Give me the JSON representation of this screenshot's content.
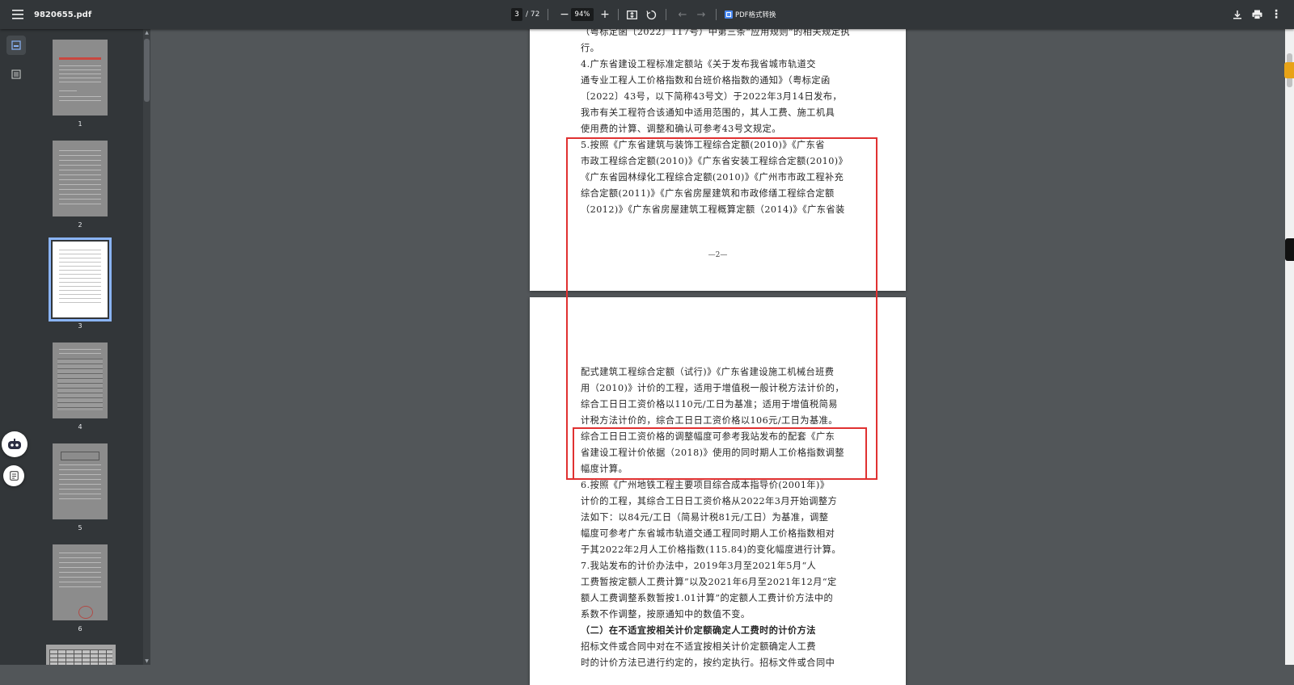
{
  "toolbar": {
    "file_name": "9820655.pdf",
    "current_page": "3",
    "page_total": "/ 72",
    "zoom": "94%",
    "zoom_out": "−",
    "zoom_in": "+",
    "back": "←",
    "forward": "→",
    "convert_label": "PDF格式转换",
    "more": "⋮"
  },
  "thumbnails": [
    {
      "label": "1",
      "kind": "cover"
    },
    {
      "label": "2",
      "kind": "text"
    },
    {
      "label": "3",
      "kind": "text",
      "selected": true
    },
    {
      "label": "4",
      "kind": "table"
    },
    {
      "label": "5",
      "kind": "text"
    },
    {
      "label": "6",
      "kind": "stamp"
    }
  ],
  "page1": {
    "lines": [
      "（粤标定函〔2022〕117号）中第三条“应用规则”的相关规定执",
      "行。",
      "    4.广东省建设工程标准定额站《关于发布我省城市轨道交",
      "通专业工程人工价格指数和台班价格指数的通知》（粤标定函",
      "〔2022〕43号，以下简称43号文）于2022年3月14日发布，",
      "我市有关工程符合该通知中适用范围的，其人工费、施工机具",
      "使用费的计算、调整和确认可参考43号文规定。",
      "    5.按照《广东省建筑与装饰工程综合定额(2010)》《广东省",
      "市政工程综合定额(2010)》《广东省安装工程综合定额(2010)》",
      "《广东省园林绿化工程综合定额(2010)》《广州市市政工程补充",
      "综合定额(2011)》《广东省房屋建筑和市政修缮工程综合定额",
      "（2012)》《广东省房屋建筑工程概算定额（2014)》《广东省装"
    ],
    "footer": "—2—"
  },
  "page2": {
    "lines": [
      "配式建筑工程综合定额（试行)》《广东省建设施工机械台班费",
      "用（2010)》计价的工程，适用于增值税一般计税方法计价的，",
      "综合工日日工资价格以110元/工日为基准；适用于增值税简易",
      "计税方法计价的，综合工日日工资价格以106元/工日为基准。",
      "综合工日日工资价格的调整幅度可参考我站发布的配套《广东",
      "省建设工程计价依据（2018)》使用的同时期人工价格指数调整",
      "幅度计算。",
      "    6.按照《广州地铁工程主要项目综合成本指导价(2001年)》",
      "计价的工程，其综合工日日工资价格从2022年3月开始调整方",
      "法如下：以84元/工日（简易计税81元/工日）为基准，调整",
      "幅度可参考广东省城市轨道交通工程同时期人工价格指数相对",
      "于其2022年2月人工价格指数(115.84)的变化幅度进行计算。",
      "    7.我站发布的计价办法中，2019年3月至2021年5月“人",
      "工费暂按定额人工费计算”以及2021年6月至2021年12月“定",
      "额人工费调整系数暂按1.01计算”的定额人工费计价方法中的",
      "系数不作调整，按原通知中的数值不变。",
      "    （二）在不适宜按相关计价定额确定人工费时的计价方法",
      "    招标文件或合同中对在不适宜按相关计价定额确定人工费",
      "时的计价方法已进行约定的，按约定执行。招标文件或合同中"
    ]
  },
  "colors": {
    "toolbar_bg": "#323639",
    "viewer_bg": "#525659",
    "highlight_red": "#e03131",
    "selected_thumb": "#8ab4f8"
  }
}
